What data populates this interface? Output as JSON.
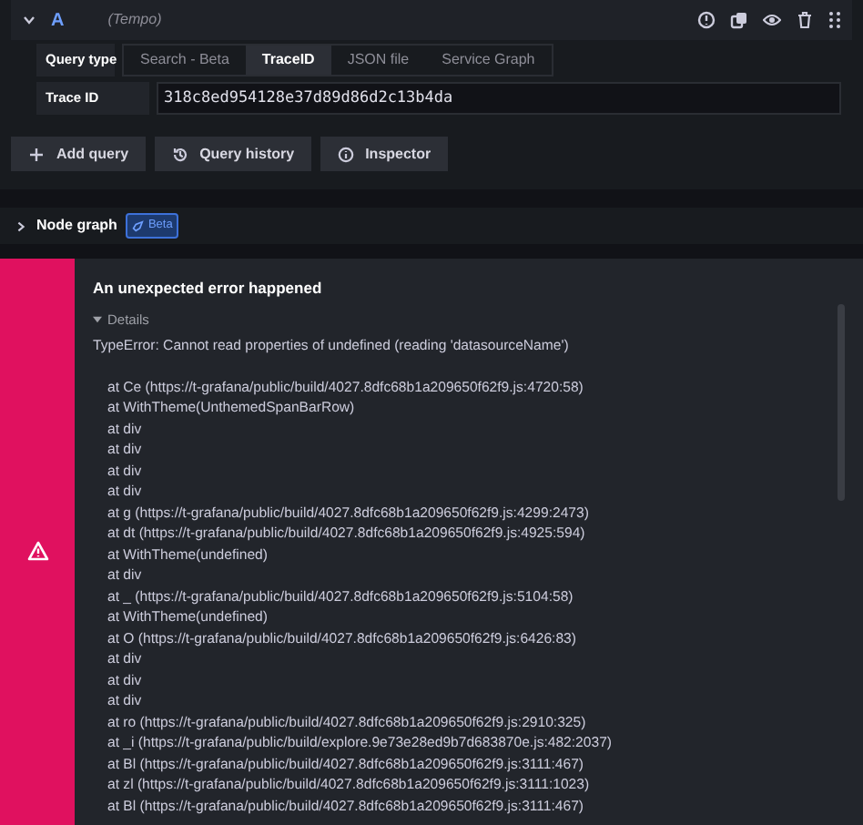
{
  "query": {
    "letter": "A",
    "datasource": "(Tempo)",
    "expanded": true
  },
  "query_type": {
    "label": "Query type",
    "tabs": [
      {
        "label": "Search - Beta",
        "selected": false
      },
      {
        "label": "TraceID",
        "selected": true
      },
      {
        "label": "JSON file",
        "selected": false
      },
      {
        "label": "Service Graph",
        "selected": false
      }
    ]
  },
  "trace_id": {
    "label": "Trace ID",
    "value": "318c8ed954128e37d89d86d2c13b4da"
  },
  "buttons": [
    {
      "label": "Add query",
      "kind": "add"
    },
    {
      "label": "Query history",
      "kind": "history"
    },
    {
      "label": "Inspector",
      "kind": "info"
    }
  ],
  "node_graph": {
    "label": "Node graph",
    "badge": "Beta",
    "expanded": false
  },
  "error": {
    "title": "An unexpected error happened",
    "details_label": "Details",
    "details_open": true,
    "message": "TypeError: Cannot read properties of undefined (reading 'datasourceName')",
    "stack": [
      "at Ce (https://t-grafana/public/build/4027.8dfc68b1a209650f62f9.js:4720:58)",
      "at WithTheme(UnthemedSpanBarRow)",
      "at div",
      "at div",
      "at div",
      "at div",
      "at g (https://t-grafana/public/build/4027.8dfc68b1a209650f62f9.js:4299:2473)",
      "at dt (https://t-grafana/public/build/4027.8dfc68b1a209650f62f9.js:4925:594)",
      "at WithTheme(undefined)",
      "at div",
      "at _ (https://t-grafana/public/build/4027.8dfc68b1a209650f62f9.js:5104:58)",
      "at WithTheme(undefined)",
      "at O (https://t-grafana/public/build/4027.8dfc68b1a209650f62f9.js:6426:83)",
      "at div",
      "at div",
      "at div",
      "at ro (https://t-grafana/public/build/4027.8dfc68b1a209650f62f9.js:2910:325)",
      "at _i (https://t-grafana/public/build/explore.9e73e28ed9b7d683870e.js:482:2037)",
      "at Bl (https://t-grafana/public/build/4027.8dfc68b1a209650f62f9.js:3111:467)",
      "at zl (https://t-grafana/public/build/4027.8dfc68b1a209650f62f9.js:3111:1023)",
      "at Bl (https://t-grafana/public/build/4027.8dfc68b1a209650f62f9.js:3111:467)"
    ]
  }
}
